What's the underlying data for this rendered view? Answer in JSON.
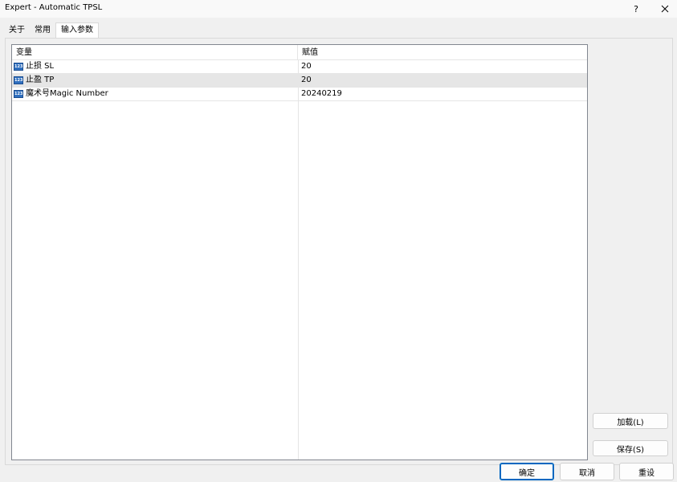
{
  "window": {
    "title": "Expert - Automatic TPSL",
    "help_label": "?",
    "close_icon": "close-icon"
  },
  "tabs": [
    {
      "label": "关于"
    },
    {
      "label": "常用"
    },
    {
      "label": "输入参数",
      "active": true
    }
  ],
  "table": {
    "headers": {
      "variable": "变量",
      "value": "赋值"
    },
    "rows": [
      {
        "icon": "int-param-icon",
        "icon_text": "123",
        "name": "止损 SL",
        "value": "20"
      },
      {
        "icon": "int-param-icon",
        "icon_text": "123",
        "name": "止盈 TP",
        "value": "20",
        "selected": true
      },
      {
        "icon": "int-param-icon",
        "icon_text": "123",
        "name": "魔术号Magic Number",
        "value": "20240219"
      }
    ]
  },
  "side_buttons": {
    "load_label": "加载(L)",
    "save_label": "保存(S)"
  },
  "bottom_buttons": {
    "ok_label": "确定",
    "cancel_label": "取消",
    "reset_label": "重设"
  },
  "colors": {
    "accent": "#0067c0",
    "param_icon": "#2f6fbf",
    "selected_row": "#e6e6e6"
  }
}
